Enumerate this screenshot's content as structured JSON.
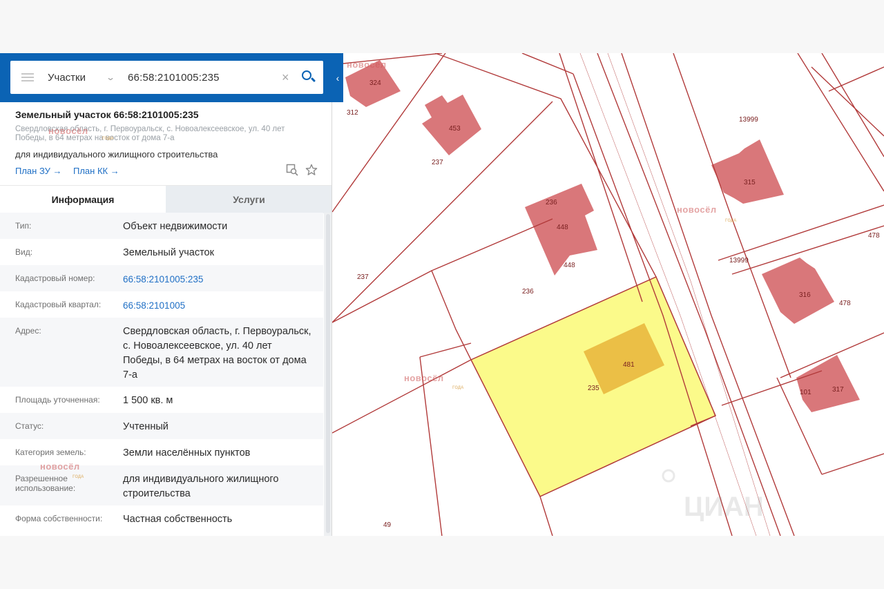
{
  "search": {
    "category": "Участки",
    "query": "66:58:2101005:235"
  },
  "plot": {
    "title": "Земельный участок 66:58:2101005:235",
    "address": "Свердловская область, г. Первоуральск, с. Новоалексеевское, ул. 40 лет Победы, в 64 метрах на восток от дома 7-а",
    "purpose": "для индивидуального жилищного строительства",
    "plan_zu": "План ЗУ →",
    "plan_kk": "План КК →"
  },
  "tabs": {
    "info": "Информация",
    "services": "Услуги"
  },
  "rows": [
    {
      "label": "Тип:",
      "value": "Объект недвижимости"
    },
    {
      "label": "Вид:",
      "value": "Земельный участок"
    },
    {
      "label": "Кадастровый номер:",
      "value": "66:58:2101005:235"
    },
    {
      "label": "Кадастровый квартал:",
      "value": "66:58:2101005"
    },
    {
      "label": "Адрес:",
      "value": "Свердловская область, г. Первоуральск, с. Новоалексеевское, ул. 40 лет Победы, в 64 метрах на восток от дома 7-а"
    },
    {
      "label": "Площадь уточненная:",
      "value": "1 500 кв. м"
    },
    {
      "label": "Статус:",
      "value": "Учтенный"
    },
    {
      "label": "Категория земель:",
      "value": "Земли населённых пунктов"
    },
    {
      "label": "Разрешенное использование:",
      "value": "для индивидуального жилищного строительства"
    },
    {
      "label": "Форма собственности:",
      "value": "Частная собственность"
    }
  ],
  "watermark": {
    "brand": "новосёл",
    "sub": "ГОДА",
    "cian": "ЦИАН"
  },
  "map": {
    "labels": {
      "l324": "324",
      "l312": "312",
      "l453": "453",
      "l237a": "237",
      "l237b": "237",
      "l13999a": "13999",
      "l13999b": "13999",
      "l315": "315",
      "l478a": "478",
      "l478b": "478",
      "l236a": "236",
      "l236b": "236",
      "l448a": "448",
      "l448b": "448",
      "l316": "316",
      "l481": "481",
      "l235": "235",
      "l101": "101",
      "l317": "317",
      "l49": "49"
    },
    "colors": {
      "boundary": "#b13a3a",
      "building": "#d9777a",
      "selected_plot": "#fbfa8a",
      "selected_building": "#e8b43a"
    }
  }
}
